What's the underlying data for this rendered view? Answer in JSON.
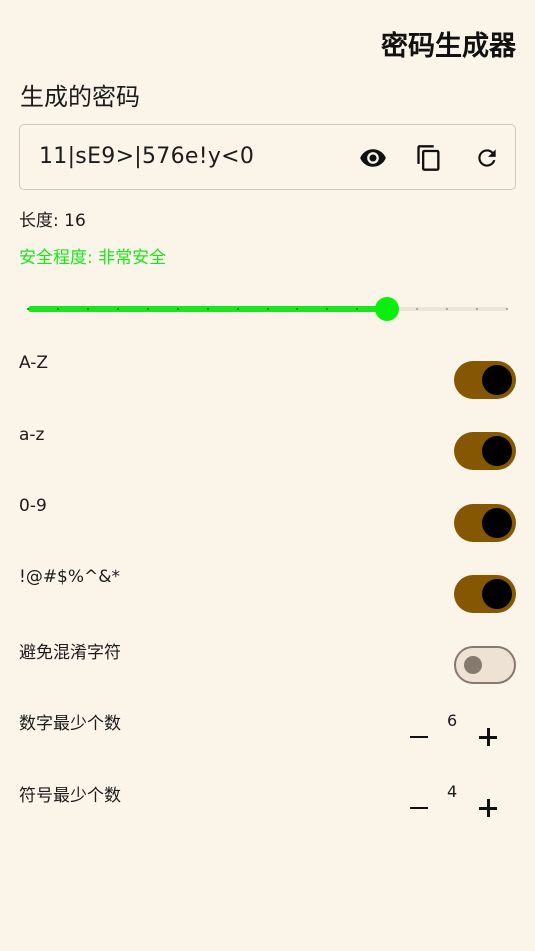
{
  "app": {
    "title": "密码生成器"
  },
  "password": {
    "section_title": "生成的密码",
    "value": "11|sE9>|576e!y<0",
    "icons": [
      "eye-icon",
      "copy-icon",
      "refresh-icon"
    ]
  },
  "length": {
    "label": "长度: 16",
    "value": 16,
    "min": 4,
    "max": 20,
    "steps": 17
  },
  "strength": {
    "label": "安全程度: 非常安全",
    "color": "#19e61c"
  },
  "options": [
    {
      "label": "A-Z",
      "enabled": true
    },
    {
      "label": "a-z",
      "enabled": true
    },
    {
      "label": "0-9",
      "enabled": true
    },
    {
      "label": "!@#$%^&*",
      "enabled": true
    },
    {
      "label": "避免混淆字符",
      "enabled": false
    }
  ],
  "min_digits": {
    "label": "数字最少个数",
    "value": "6"
  },
  "min_symbols": {
    "label": "符号最少个数",
    "value": "4"
  },
  "colors": {
    "background": "#fbf4e8",
    "accent": "#855702",
    "slider_active": "#19e61c",
    "toggle_off_track": "#ede2d4",
    "toggle_off_knob": "#857a6d"
  }
}
